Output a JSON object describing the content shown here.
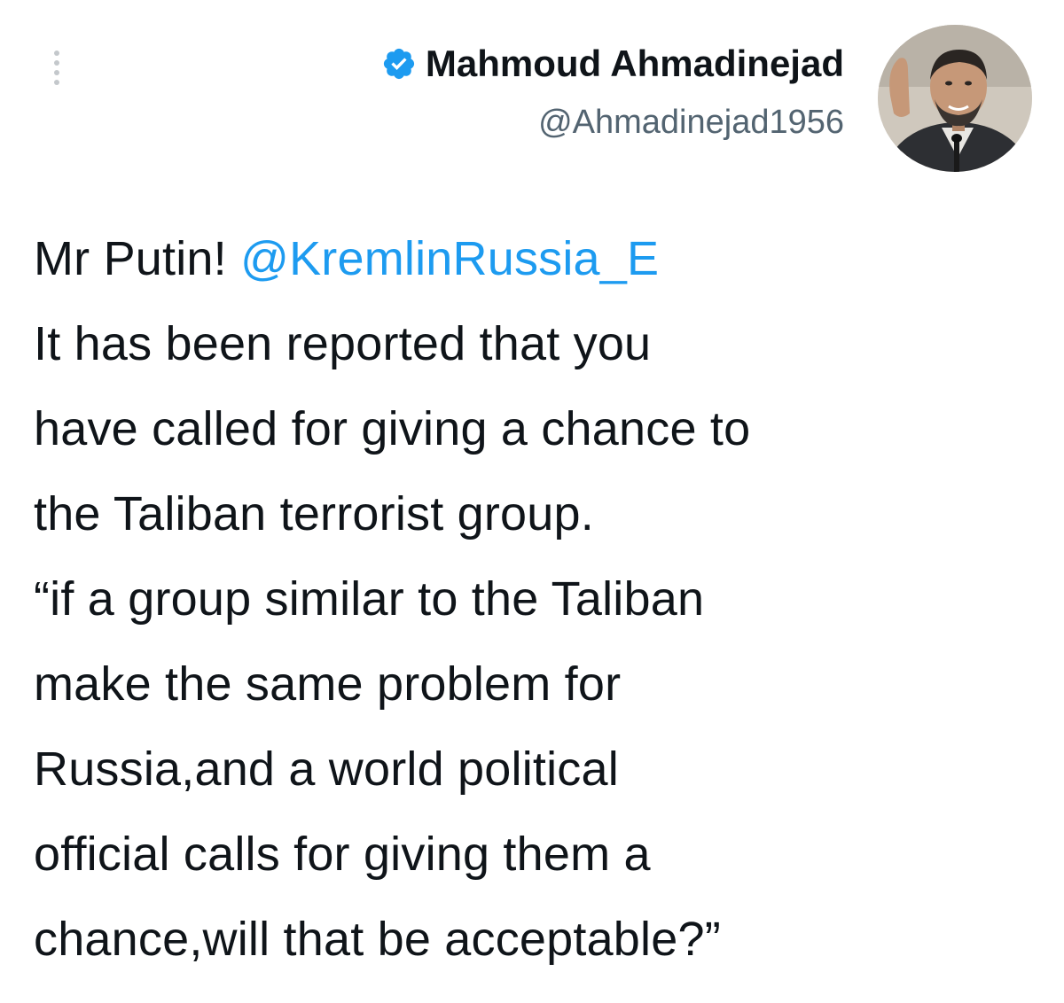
{
  "author": {
    "display_name": "Mahmoud Ahmadinejad",
    "handle": "@Ahmadinejad1956",
    "verified_icon": "verified-badge-icon",
    "avatar_icon": "profile-photo"
  },
  "more_icon": "more-vertical-icon",
  "tweet": {
    "line1_prefix": "Mr Putin! ",
    "mention": "@KremlinRussia_E",
    "lines": [
      "It has been reported that you",
      "have called for giving a chance to",
      "the Taliban terrorist group.",
      "“if a group similar to the Taliban",
      "make the same problem for",
      "Russia,and a world political",
      "official calls for giving them a",
      "chance,will that be acceptable?”"
    ]
  },
  "colors": {
    "link": "#1d9bf0",
    "verified": "#1d9bf0",
    "text": "#0f1419",
    "secondary": "#536471"
  }
}
